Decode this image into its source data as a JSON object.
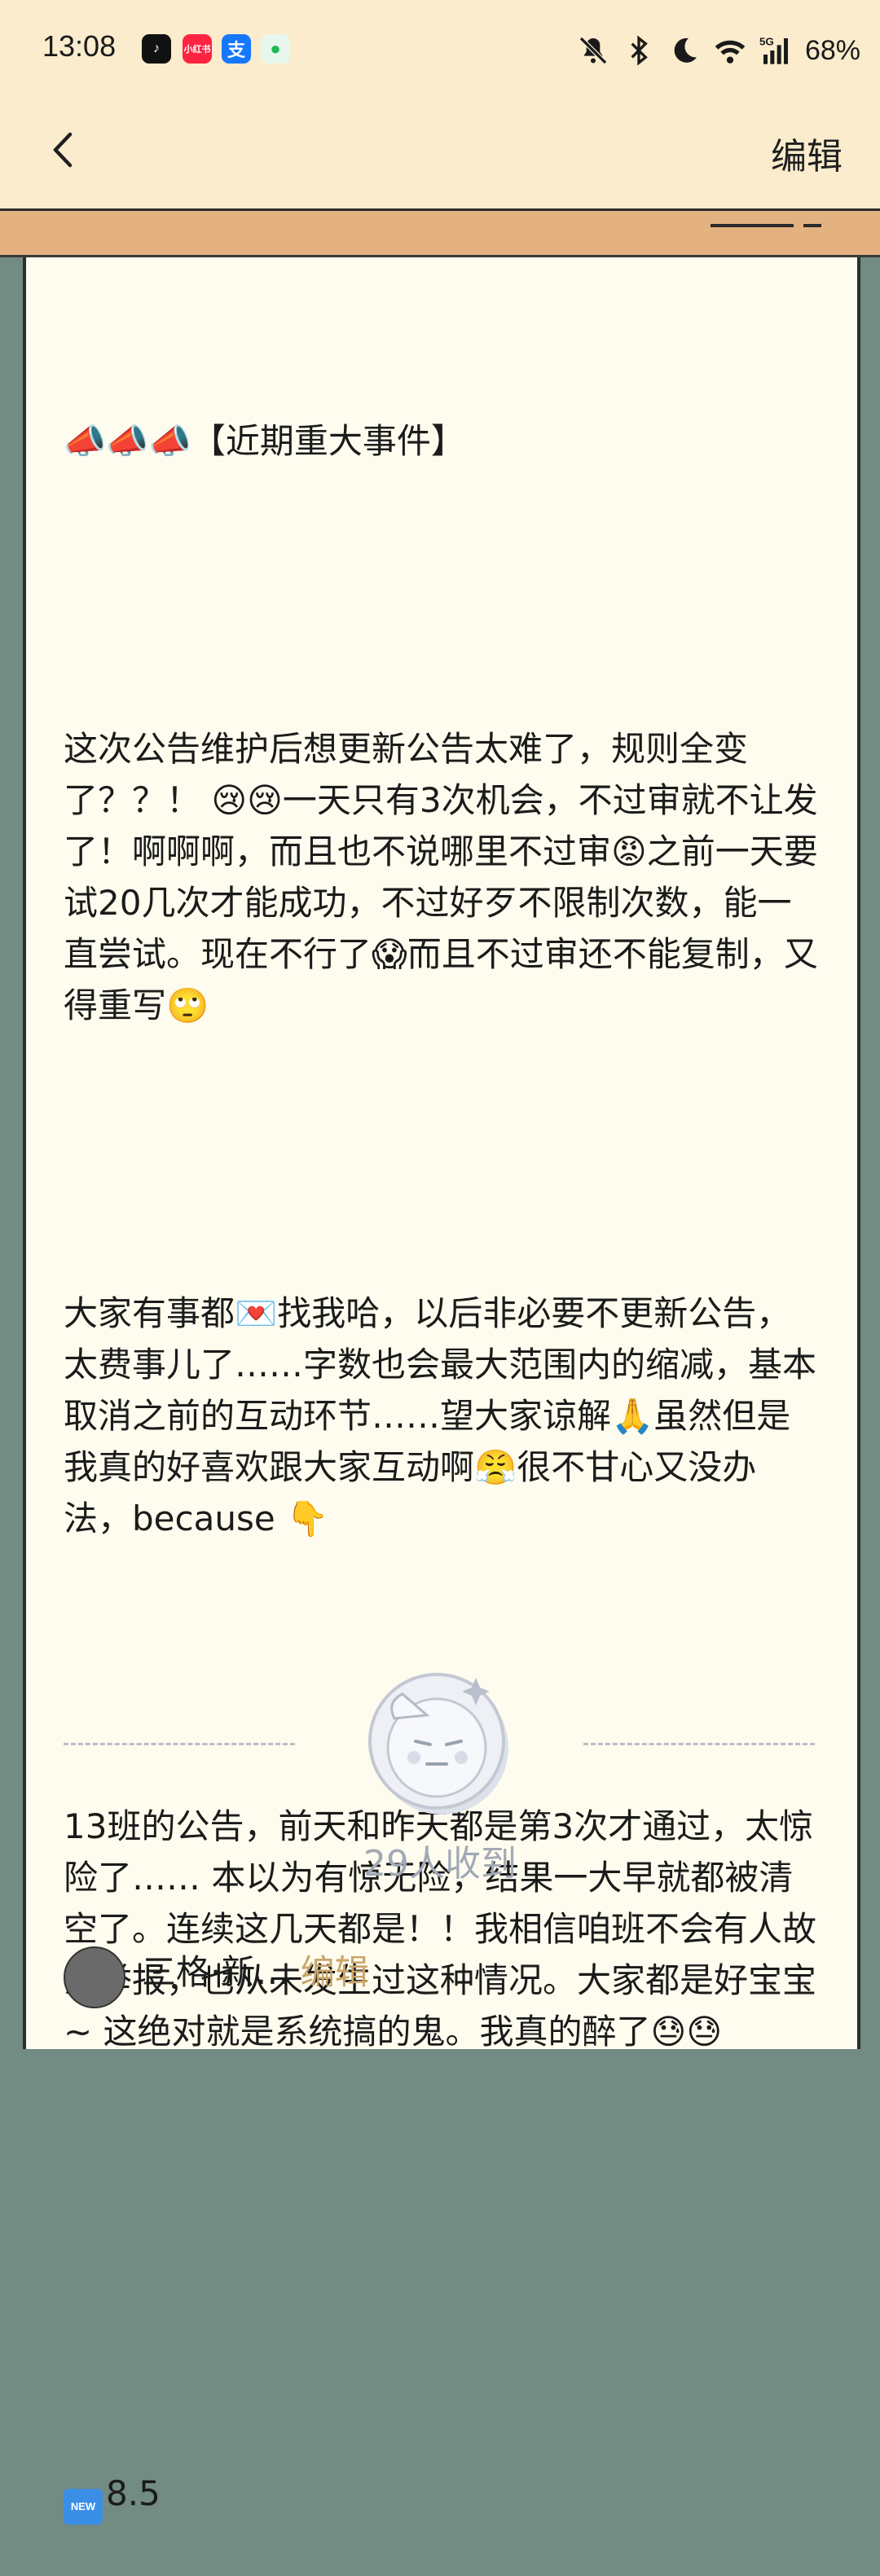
{
  "status_bar": {
    "time": "13:08",
    "apps": [
      {
        "name": "tiktok-icon",
        "label": "♪",
        "color": "#000000"
      },
      {
        "name": "xiaohongshu-icon",
        "label": "小红书",
        "color": "#ff2442"
      },
      {
        "name": "alipay-icon",
        "label": "支",
        "color": "#1677ff"
      },
      {
        "name": "spotify-like-icon",
        "label": "●",
        "color": "#1db954"
      }
    ],
    "network": "5G",
    "battery": "68%"
  },
  "nav": {
    "back_icon": "chevron-left-icon",
    "edit_label": "编辑"
  },
  "post": {
    "title": "📣📣📣【近期重大事件】",
    "para1": "这次公告维护后想更新公告太难了，规则全变了？？！ 😢😢一天只有3次机会，不过审就不让发了！啊啊啊，而且也不说哪里不过审😡之前一天要试20几次才能成功，不过好歹不限制次数，能一直尝试。现在不行了😱而且不过审还不能复制，又得重写🙄",
    "para2": "大家有事都💌找我哈，以后非必要不更新公告，太费事儿了……字数也会最大范围内的缩减，基本取消之前的互动环节……望大家谅解🙏虽然但是我真的好喜欢跟大家互动啊😤很不甘心又没办法，because 👇",
    "para3": "13班的公告，前天和昨天都是第3次才通过，太惊险了…… 本以为有惊无险，结果一大早就都被清空了。连续这几天都是！！我相信咱班不会有人故意举报，也从未发生过这种情况。大家都是好宝宝 ~ 这绝对就是系统搞的鬼。我真的醉了😓😓",
    "new_badge": "NEW",
    "version": "8.5"
  },
  "footer": {
    "received": "29人收到",
    "bottom_text": "三格·新…编辑",
    "bottom_name": "三格·新…",
    "bottom_link": "编辑"
  },
  "colors": {
    "header": "#faeccc",
    "tape": "#e4b180",
    "card": "#fefcee",
    "side": "#728b83"
  }
}
